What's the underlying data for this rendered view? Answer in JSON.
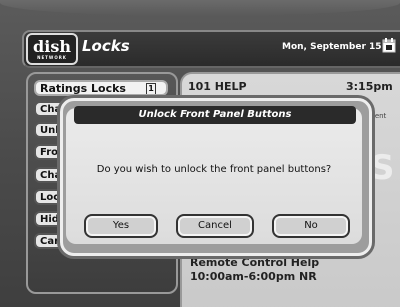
{
  "header": {
    "logo_text": "dish",
    "logo_subtext": "NETWORK",
    "title": "Locks",
    "date": "Mon, September 15"
  },
  "menu": {
    "items": [
      {
        "label": "Ratings Locks",
        "number": "1"
      },
      {
        "label": "Cha"
      },
      {
        "label": "Unl"
      },
      {
        "label": "Fron"
      },
      {
        "label": "Cha"
      },
      {
        "label": "Loc"
      },
      {
        "label": "Hid"
      },
      {
        "label": "Canc"
      }
    ]
  },
  "info_panel": {
    "channel": "101 HELP",
    "time": "3:15pm",
    "peek_text": "ment",
    "peek_letter": "S",
    "program_title": "Remote Control Help",
    "program_times": "10:00am-6:00pm NR"
  },
  "dialog": {
    "title": "Unlock Front Panel Buttons",
    "message": "Do you wish to unlock the front panel buttons?",
    "buttons": {
      "yes": "Yes",
      "cancel": "Cancel",
      "no": "No"
    }
  },
  "icons": {
    "calendar": "calendar-icon"
  }
}
